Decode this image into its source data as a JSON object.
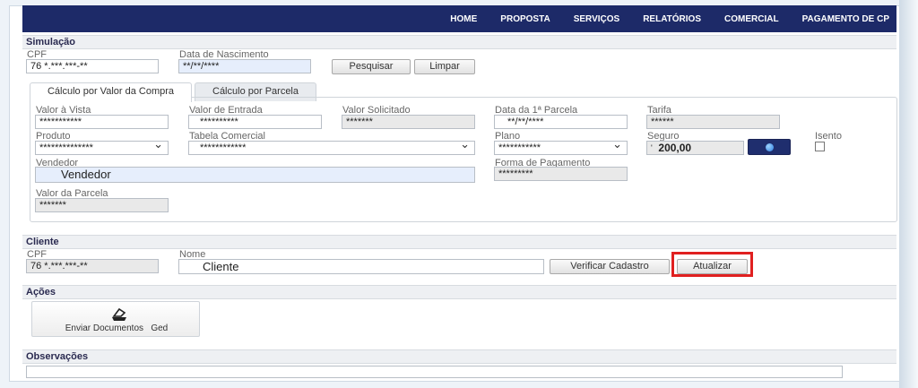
{
  "nav": [
    "HOME",
    "PROPOSTA",
    "SERVIÇOS",
    "RELATÓRIOS",
    "COMERCIAL",
    "PAGAMENTO DE CP"
  ],
  "simulacao": {
    "header": "Simulação",
    "cpf_label": "CPF",
    "cpf_value": "76 *.***.***-**",
    "nascimento_label": "Data de Nascimento",
    "nascimento_value": "**/**/****",
    "pesquisar": "Pesquisar",
    "limpar": "Limpar"
  },
  "tabs": [
    "Cálculo por Valor da Compra",
    "Cálculo por Parcela"
  ],
  "form": {
    "valor_vista_label": "Valor à Vista",
    "valor_vista_value": "***********",
    "valor_entrada_label": "Valor de Entrada",
    "valor_entrada_value": "**********",
    "valor_solicitado_label": "Valor Solicitado",
    "valor_solicitado_value": "*******",
    "data_parcela_label": "Data da 1ª Parcela",
    "data_parcela_value": "**/**/****",
    "tarifa_label": "Tarifa",
    "tarifa_value": "******",
    "produto_label": "Produto",
    "produto_value": "**************",
    "tabela_label": "Tabela Comercial",
    "tabela_value": "************",
    "plano_label": "Plano",
    "plano_value": "***********",
    "seguro_label": "Seguro",
    "seguro_prefix": "'",
    "seguro_value": "200,00",
    "isento_label": "Isento",
    "vendedor_label": "Vendedor",
    "vendedor_value": "Vendedor",
    "forma_label": "Forma de Pagamento",
    "forma_value": "*********",
    "valor_parcela_label": "Valor da Parcela",
    "valor_parcela_value": "*******"
  },
  "cliente": {
    "header": "Cliente",
    "cpf_label": "CPF",
    "cpf_value": "76 *.***.***-**",
    "nome_label": "Nome",
    "nome_value": "Cliente",
    "verificar": "Verificar Cadastro",
    "atualizar": "Atualizar"
  },
  "acoes": {
    "header": "Ações",
    "enviar": "Enviar Documentos   Ged"
  },
  "observacoes": {
    "header": "Observações"
  }
}
